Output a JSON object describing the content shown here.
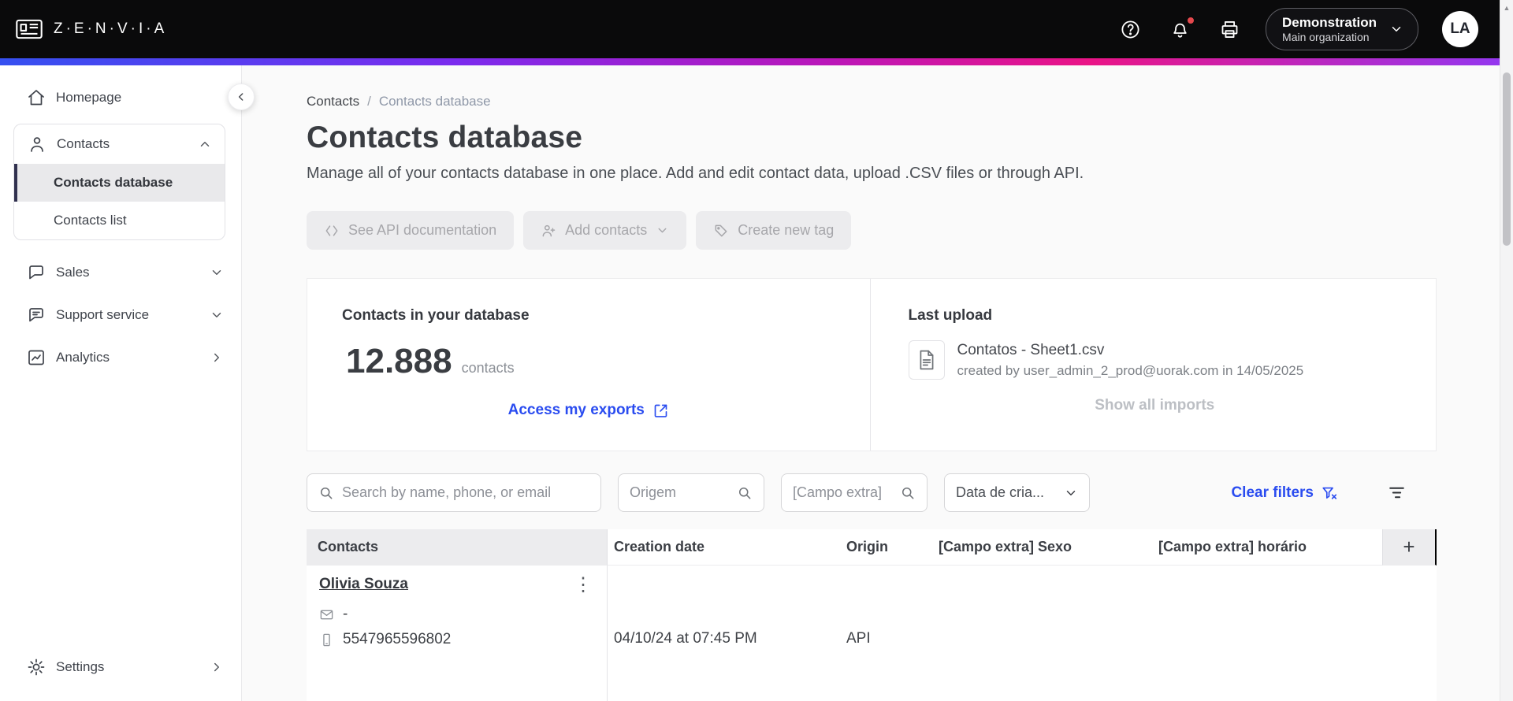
{
  "colors": {
    "link_blue": "#2a4cf0",
    "badge_red": "#e5484d",
    "active_indicator": "#31314f"
  },
  "topbar": {
    "brand": "Z·E·N·V·I·A",
    "org": {
      "name": "Demonstration",
      "sub": "Main organization"
    },
    "avatar_initials": "LA"
  },
  "sidebar": {
    "homepage": "Homepage",
    "contacts": "Contacts",
    "contacts_database": "Contacts database",
    "contacts_list": "Contacts list",
    "sales": "Sales",
    "support": "Support service",
    "analytics": "Analytics",
    "settings": "Settings"
  },
  "breadcrumb": {
    "parent": "Contacts",
    "separator": "/",
    "current": "Contacts database"
  },
  "page": {
    "title": "Contacts database",
    "subtitle": "Manage all of your contacts database in one place. Add and edit contact data, upload .CSV files or through API."
  },
  "actions": {
    "see_api_documentation": "See API documentation",
    "add_contacts": "Add contacts",
    "create_new_tag": "Create new tag"
  },
  "stats": {
    "title": "Contacts in your database",
    "count": "12.888",
    "unit": "contacts",
    "exports_link": "Access my exports"
  },
  "last_upload": {
    "title": "Last upload",
    "file_name": "Contatos - Sheet1.csv",
    "meta": "created by user_admin_2_prod@uorak.com in 14/05/2025",
    "show_all": "Show all imports"
  },
  "filters": {
    "search_placeholder": "Search by name, phone, or email",
    "origin_placeholder": "Origem",
    "extra_field_placeholder": "[Campo extra]",
    "date_filter": "Data de cria...",
    "clear": "Clear filters"
  },
  "table": {
    "headers": [
      "Contacts",
      "Creation date",
      "Origin",
      "[Campo extra] Sexo",
      "[Campo extra] horário"
    ],
    "add_column": "+",
    "rows": [
      {
        "name": "Olivia Souza",
        "email": "-",
        "phone": "5547965596802",
        "creation_date": "04/10/24 at 07:45 PM",
        "origin": "API"
      }
    ]
  },
  "icons": {
    "kebab": "⋮"
  }
}
